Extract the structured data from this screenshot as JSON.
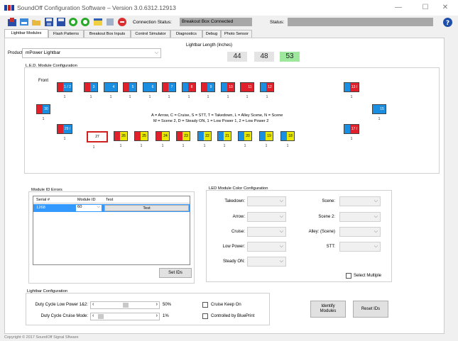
{
  "window": {
    "title": "SoundOff Configuration Software – Version 3.0.6312.12913",
    "minimize": "—",
    "maximize": "☐",
    "close": "✕"
  },
  "toolbar": {
    "connection_label": "Connection Status:",
    "connection_value": "Breakout Box Connected",
    "status_label": "Status:",
    "status_value": "",
    "help_glyph": "?"
  },
  "tabs": [
    "Lightbar Modules",
    "Flash Patterns",
    "Breakout Box Inputs",
    "Control Simulator",
    "Diagnostics",
    "Debug",
    "Photo Sensor"
  ],
  "product": {
    "label": "Product:",
    "value": "mPower Lightbar"
  },
  "lightbar_length": {
    "label": "Lightbar Length (Inches)",
    "options": [
      "44",
      "48",
      "53"
    ],
    "selected": "53"
  },
  "led_config": {
    "title": "L.E.D. Module Configuration",
    "front_label": "Front",
    "legend_line1": "A = Arrow, C = Cruise, S = STT, T = Takedown, L = Alley Scene, N = Scene",
    "legend_line2": "M = Scene 2, D = Steady ON, 1 = Low Power 1, 2 = Low Power 2",
    "top_row": [
      {
        "label": "1 / 2",
        "c1": "#e0202a",
        "c2": "#1a8ee0",
        "num": "1"
      },
      {
        "label": "3",
        "c1": "#e0202a",
        "c2": "#1a8ee0",
        "num": "1"
      },
      {
        "label": "4",
        "c1": "#1a8ee0",
        "c2": "#1a8ee0",
        "num": "1"
      },
      {
        "label": "5",
        "c1": "#e0202a",
        "c2": "#1a8ee0",
        "num": "1"
      },
      {
        "label": "6",
        "c1": "#1a8ee0",
        "c2": "#1a8ee0",
        "num": "1"
      },
      {
        "label": "7",
        "c1": "#e0202a",
        "c2": "#1a8ee0",
        "num": "1"
      },
      {
        "label": "8",
        "c1": "#1a8ee0",
        "c2": "#e0202a",
        "num": "1"
      },
      {
        "label": "9",
        "c1": "#e0202a",
        "c2": "#1a8ee0",
        "num": "1"
      },
      {
        "label": "10",
        "c1": "#1a8ee0",
        "c2": "#e0202a",
        "num": "1"
      },
      {
        "label": "11",
        "c1": "#e0202a",
        "c2": "#e0202a",
        "num": "1"
      },
      {
        "label": "12",
        "c1": "#1a8ee0",
        "c2": "#e0202a",
        "num": "1"
      },
      {
        "label": "13 / 14",
        "c1": "#1a8ee0",
        "c2": "#e0202a",
        "num": "1"
      }
    ],
    "left_end": {
      "label": "30",
      "c1": "#e0202a",
      "c2": "#1a8ee0",
      "num": "1"
    },
    "right_end": {
      "label": "15",
      "c1": "#1a8ee0",
      "c2": "#1a8ee0",
      "num": "1"
    },
    "bottom_left": {
      "label": "29 / 28",
      "c1": "#e0202a",
      "c2": "#1a8ee0",
      "num": "1"
    },
    "bottom_right": {
      "label": "17 / 16",
      "c1": "#1a8ee0",
      "c2": "#e0202a",
      "num": "1"
    },
    "bottom_row": [
      {
        "label": "27",
        "c1": "#ffffff",
        "c2": "#ffffff",
        "num": "1",
        "selected": true
      },
      {
        "label": "26",
        "c1": "#e0202a",
        "c2": "#e8e800",
        "num": "1"
      },
      {
        "label": "25",
        "c1": "#e0202a",
        "c2": "#e8e800",
        "num": "1"
      },
      {
        "label": "24",
        "c1": "#e0202a",
        "c2": "#e8e800",
        "num": "1"
      },
      {
        "label": "23",
        "c1": "#e0202a",
        "c2": "#e8e800",
        "num": "1"
      },
      {
        "label": "22",
        "c1": "#1a8ee0",
        "c2": "#e8e800",
        "num": "1"
      },
      {
        "label": "21",
        "c1": "#1a8ee0",
        "c2": "#e8e800",
        "num": "1"
      },
      {
        "label": "20",
        "c1": "#1a8ee0",
        "c2": "#e8e800",
        "num": "1"
      },
      {
        "label": "19",
        "c1": "#1a8ee0",
        "c2": "#e8e800",
        "num": "1"
      },
      {
        "label": "18",
        "c1": "#1a8ee0",
        "c2": "#e8e800",
        "num": "1"
      }
    ]
  },
  "module_errors": {
    "title": "Module ID Errors",
    "headers": [
      "Serial #",
      "Module ID",
      "Test"
    ],
    "row": {
      "serial": "1268",
      "module_id": "60",
      "test": "Test"
    },
    "set_ids": "Set IDs"
  },
  "color_config": {
    "title": "LED Module Color Configuration",
    "left_fields": [
      "Takedown:",
      "Arrow:",
      "Cruise:",
      "Low Power:",
      "Steady ON:"
    ],
    "right_fields": [
      "Scene:",
      "Scene 2:",
      "Alley: (Scene)",
      "STT:"
    ],
    "select_multiple": "Select Multiple"
  },
  "lightbar_config": {
    "title": "Lightbar Configuration",
    "duty_low_label": "Duty Cycle Low Power 1&2:",
    "duty_low_value": "50%",
    "duty_low_level": 0.5,
    "duty_cruise_label": "Duty Cycle Cruise Mode:",
    "duty_cruise_value": "1%",
    "duty_cruise_level": 0.01,
    "cruise_keep_on": "Cruise Keep On",
    "controlled_by_blueprint": "Controlled by BluePrint",
    "identify_modules": "Identify Modules",
    "reset_ids": "Reset IDs"
  },
  "footer": "Copyright © 2017 SoundOff Signal        Sftware"
}
